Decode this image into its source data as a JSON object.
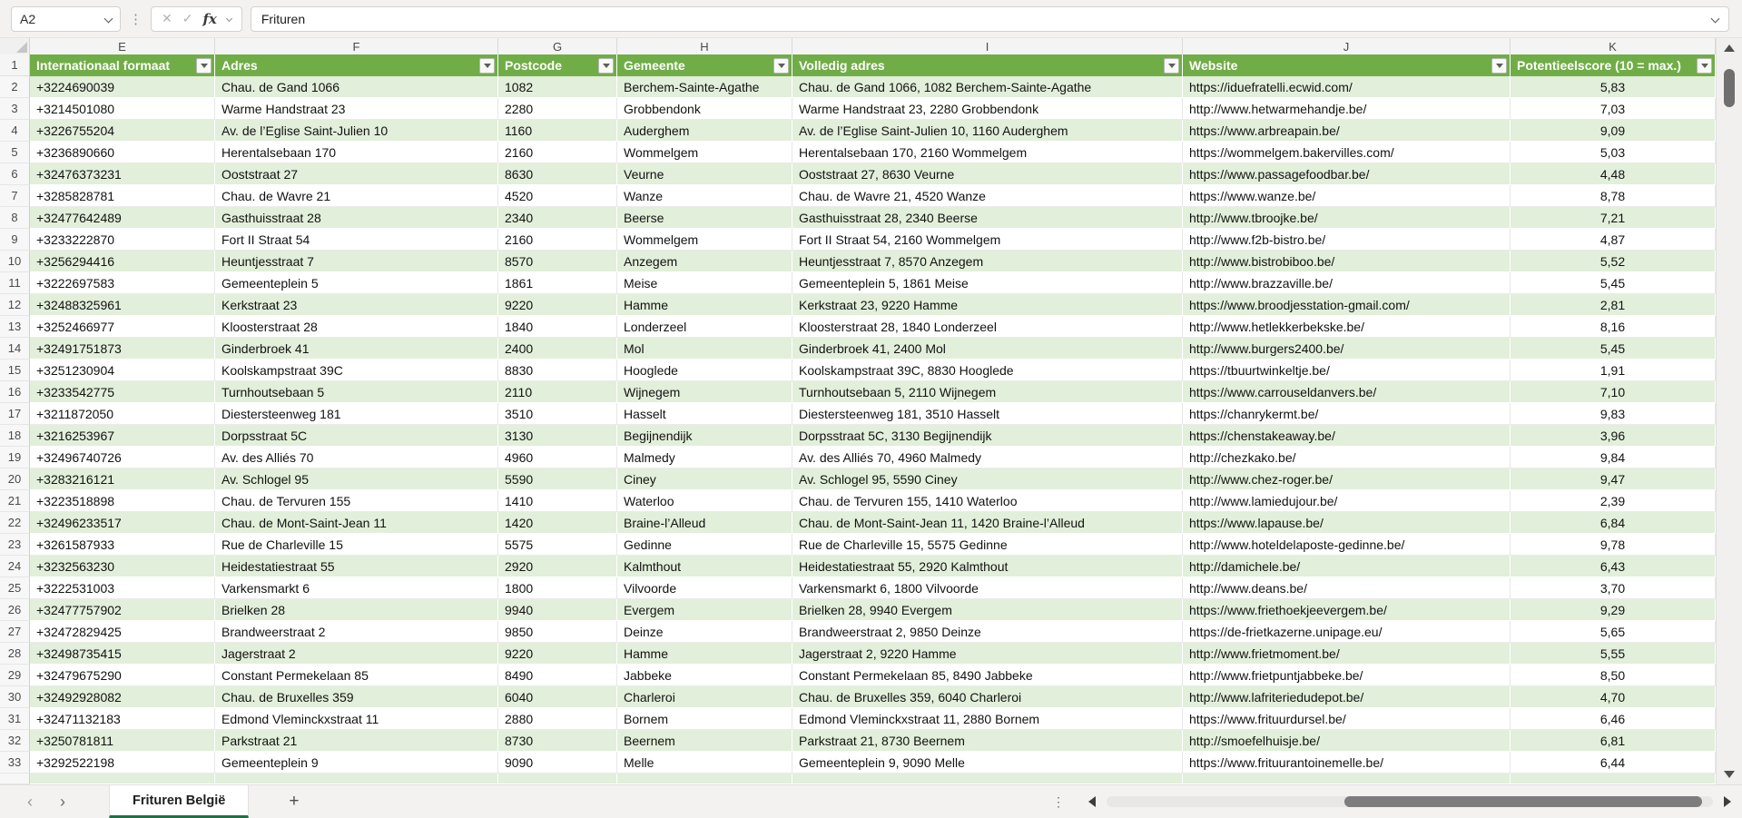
{
  "formula_bar": {
    "cell_reference": "A2",
    "formula_value": "Frituren",
    "fx_label": "fx",
    "cancel_glyph": "✕",
    "enter_glyph": "✓"
  },
  "icons": {
    "more_options_dots": "⋮",
    "sheet_prev": "‹",
    "sheet_next": "›"
  },
  "colors": {
    "header_green": "#70AD47",
    "band_green": "#E2EFDA",
    "tab_underline_green": "#1E7145"
  },
  "header_row_number": "1",
  "columns": [
    {
      "letter": "E",
      "key": "phone",
      "label": "Internationaal formaat"
    },
    {
      "letter": "F",
      "key": "address",
      "label": "Adres"
    },
    {
      "letter": "G",
      "key": "postcode",
      "label": "Postcode"
    },
    {
      "letter": "H",
      "key": "municipality",
      "label": "Gemeente"
    },
    {
      "letter": "I",
      "key": "full_address",
      "label": "Volledig adres"
    },
    {
      "letter": "J",
      "key": "website",
      "label": "Website"
    },
    {
      "letter": "K",
      "key": "score",
      "label": "Potentieelscore (10 = max.)"
    }
  ],
  "rows": [
    {
      "n": 2,
      "phone": "+3224690039",
      "address": "Chau. de Gand 1066",
      "postcode": "1082",
      "municipality": "Berchem-Sainte-Agathe",
      "full_address": "Chau. de Gand 1066, 1082 Berchem-Sainte-Agathe",
      "website": "https://iduefratelli.ecwid.com/",
      "score": "5,83"
    },
    {
      "n": 3,
      "phone": "+3214501080",
      "address": "Warme Handstraat 23",
      "postcode": "2280",
      "municipality": "Grobbendonk",
      "full_address": "Warme Handstraat 23, 2280 Grobbendonk",
      "website": "http://www.hetwarmehandje.be/",
      "score": "7,03"
    },
    {
      "n": 4,
      "phone": "+3226755204",
      "address": "Av. de l’Eglise Saint-Julien 10",
      "postcode": "1160",
      "municipality": "Auderghem",
      "full_address": "Av. de l’Eglise Saint-Julien 10, 1160 Auderghem",
      "website": "https://www.arbreapain.be/",
      "score": "9,09"
    },
    {
      "n": 5,
      "phone": "+3236890660",
      "address": "Herentalsebaan 170",
      "postcode": "2160",
      "municipality": "Wommelgem",
      "full_address": "Herentalsebaan 170, 2160 Wommelgem",
      "website": "https://wommelgem.bakervilles.com/",
      "score": "5,03"
    },
    {
      "n": 6,
      "phone": "+32476373231",
      "address": "Ooststraat 27",
      "postcode": "8630",
      "municipality": "Veurne",
      "full_address": "Ooststraat 27, 8630 Veurne",
      "website": "https://www.passagefoodbar.be/",
      "score": "4,48"
    },
    {
      "n": 7,
      "phone": "+3285828781",
      "address": "Chau. de Wavre 21",
      "postcode": "4520",
      "municipality": "Wanze",
      "full_address": "Chau. de Wavre 21, 4520 Wanze",
      "website": "https://www.wanze.be/",
      "score": "8,78"
    },
    {
      "n": 8,
      "phone": "+32477642489",
      "address": "Gasthuisstraat 28",
      "postcode": "2340",
      "municipality": "Beerse",
      "full_address": "Gasthuisstraat 28, 2340 Beerse",
      "website": "http://www.tbroojke.be/",
      "score": "7,21"
    },
    {
      "n": 9,
      "phone": "+3233222870",
      "address": "Fort II Straat 54",
      "postcode": "2160",
      "municipality": "Wommelgem",
      "full_address": "Fort II Straat 54, 2160 Wommelgem",
      "website": "http://www.f2b-bistro.be/",
      "score": "4,87"
    },
    {
      "n": 10,
      "phone": "+3256294416",
      "address": "Heuntjesstraat 7",
      "postcode": "8570",
      "municipality": "Anzegem",
      "full_address": "Heuntjesstraat 7, 8570 Anzegem",
      "website": "http://www.bistrobiboo.be/",
      "score": "5,52"
    },
    {
      "n": 11,
      "phone": "+3222697583",
      "address": "Gemeenteplein 5",
      "postcode": "1861",
      "municipality": "Meise",
      "full_address": "Gemeenteplein 5, 1861 Meise",
      "website": "http://www.brazzaville.be/",
      "score": "5,45"
    },
    {
      "n": 12,
      "phone": "+32488325961",
      "address": "Kerkstraat 23",
      "postcode": "9220",
      "municipality": "Hamme",
      "full_address": "Kerkstraat 23, 9220 Hamme",
      "website": "https://www.broodjesstation-gmail.com/",
      "score": "2,81"
    },
    {
      "n": 13,
      "phone": "+3252466977",
      "address": "Kloosterstraat 28",
      "postcode": "1840",
      "municipality": "Londerzeel",
      "full_address": "Kloosterstraat 28, 1840 Londerzeel",
      "website": "http://www.hetlekkerbekske.be/",
      "score": "8,16"
    },
    {
      "n": 14,
      "phone": "+32491751873",
      "address": "Ginderbroek 41",
      "postcode": "2400",
      "municipality": "Mol",
      "full_address": "Ginderbroek 41, 2400 Mol",
      "website": "http://www.burgers2400.be/",
      "score": "5,45"
    },
    {
      "n": 15,
      "phone": "+3251230904",
      "address": "Koolskampstraat 39C",
      "postcode": "8830",
      "municipality": "Hooglede",
      "full_address": "Koolskampstraat 39C, 8830 Hooglede",
      "website": "https://tbuurtwinkeltje.be/",
      "score": "1,91"
    },
    {
      "n": 16,
      "phone": "+3233542775",
      "address": "Turnhoutsebaan 5",
      "postcode": "2110",
      "municipality": "Wijnegem",
      "full_address": "Turnhoutsebaan 5, 2110 Wijnegem",
      "website": "https://www.carrouseldanvers.be/",
      "score": "7,10"
    },
    {
      "n": 17,
      "phone": "+3211872050",
      "address": "Diestersteenweg 181",
      "postcode": "3510",
      "municipality": "Hasselt",
      "full_address": "Diestersteenweg 181, 3510 Hasselt",
      "website": "https://chanrykermt.be/",
      "score": "9,83"
    },
    {
      "n": 18,
      "phone": "+3216253967",
      "address": "Dorpsstraat 5C",
      "postcode": "3130",
      "municipality": "Begijnendijk",
      "full_address": "Dorpsstraat 5C, 3130 Begijnendijk",
      "website": "https://chenstakeaway.be/",
      "score": "3,96"
    },
    {
      "n": 19,
      "phone": "+32496740726",
      "address": "Av. des Alliés 70",
      "postcode": "4960",
      "municipality": "Malmedy",
      "full_address": "Av. des Alliés 70, 4960 Malmedy",
      "website": "http://chezkako.be/",
      "score": "9,84"
    },
    {
      "n": 20,
      "phone": "+3283216121",
      "address": "Av. Schlogel 95",
      "postcode": "5590",
      "municipality": "Ciney",
      "full_address": "Av. Schlogel 95, 5590 Ciney",
      "website": "http://www.chez-roger.be/",
      "score": "9,47"
    },
    {
      "n": 21,
      "phone": "+3223518898",
      "address": "Chau. de Tervuren 155",
      "postcode": "1410",
      "municipality": "Waterloo",
      "full_address": "Chau. de Tervuren 155, 1410 Waterloo",
      "website": "http://www.lamiedujour.be/",
      "score": "2,39"
    },
    {
      "n": 22,
      "phone": "+32496233517",
      "address": "Chau. de Mont-Saint-Jean 11",
      "postcode": "1420",
      "municipality": "Braine-l’Alleud",
      "full_address": "Chau. de Mont-Saint-Jean 11, 1420 Braine-l’Alleud",
      "website": "https://www.lapause.be/",
      "score": "6,84"
    },
    {
      "n": 23,
      "phone": "+3261587933",
      "address": "Rue de Charleville 15",
      "postcode": "5575",
      "municipality": "Gedinne",
      "full_address": "Rue de Charleville 15, 5575 Gedinne",
      "website": "http://www.hoteldelaposte-gedinne.be/",
      "score": "9,78"
    },
    {
      "n": 24,
      "phone": "+3232563230",
      "address": "Heidestatiestraat 55",
      "postcode": "2920",
      "municipality": "Kalmthout",
      "full_address": "Heidestatiestraat 55, 2920 Kalmthout",
      "website": "http://damichele.be/",
      "score": "6,43"
    },
    {
      "n": 25,
      "phone": "+3222531003",
      "address": "Varkensmarkt 6",
      "postcode": "1800",
      "municipality": "Vilvoorde",
      "full_address": "Varkensmarkt 6, 1800 Vilvoorde",
      "website": "http://www.deans.be/",
      "score": "3,70"
    },
    {
      "n": 26,
      "phone": "+32477757902",
      "address": "Brielken 28",
      "postcode": "9940",
      "municipality": "Evergem",
      "full_address": "Brielken 28, 9940 Evergem",
      "website": "https://www.friethoekjeevergem.be/",
      "score": "9,29"
    },
    {
      "n": 27,
      "phone": "+32472829425",
      "address": "Brandweerstraat 2",
      "postcode": "9850",
      "municipality": "Deinze",
      "full_address": "Brandweerstraat 2, 9850 Deinze",
      "website": "https://de-frietkazerne.unipage.eu/",
      "score": "5,65"
    },
    {
      "n": 28,
      "phone": "+32498735415",
      "address": "Jagerstraat 2",
      "postcode": "9220",
      "municipality": "Hamme",
      "full_address": "Jagerstraat 2, 9220 Hamme",
      "website": "http://www.frietmoment.be/",
      "score": "5,55"
    },
    {
      "n": 29,
      "phone": "+32479675290",
      "address": "Constant Permekelaan 85",
      "postcode": "8490",
      "municipality": "Jabbeke",
      "full_address": "Constant Permekelaan 85, 8490 Jabbeke",
      "website": "http://www.frietpuntjabbeke.be/",
      "score": "8,50"
    },
    {
      "n": 30,
      "phone": "+32492928082",
      "address": "Chau. de Bruxelles 359",
      "postcode": "6040",
      "municipality": "Charleroi",
      "full_address": "Chau. de Bruxelles 359, 6040 Charleroi",
      "website": "http://www.lafriteriedudepot.be/",
      "score": "4,70"
    },
    {
      "n": 31,
      "phone": "+32471132183",
      "address": "Edmond Vleminckxstraat 11",
      "postcode": "2880",
      "municipality": "Bornem",
      "full_address": "Edmond Vleminckxstraat 11, 2880 Bornem",
      "website": "https://www.frituurdursel.be/",
      "score": "6,46"
    },
    {
      "n": 32,
      "phone": "+3250781811",
      "address": "Parkstraat 21",
      "postcode": "8730",
      "municipality": "Beernem",
      "full_address": "Parkstraat 21, 8730 Beernem",
      "website": "http://smoefelhuisje.be/",
      "score": "6,81"
    },
    {
      "n": 33,
      "phone": "+3292522198",
      "address": "Gemeenteplein 9",
      "postcode": "9090",
      "municipality": "Melle",
      "full_address": "Gemeenteplein 9, 9090 Melle",
      "website": "https://www.frituurantoinemelle.be/",
      "score": "6,44"
    }
  ],
  "sheet_tabs": {
    "active_tab": "Frituren België",
    "add_label": "+"
  }
}
